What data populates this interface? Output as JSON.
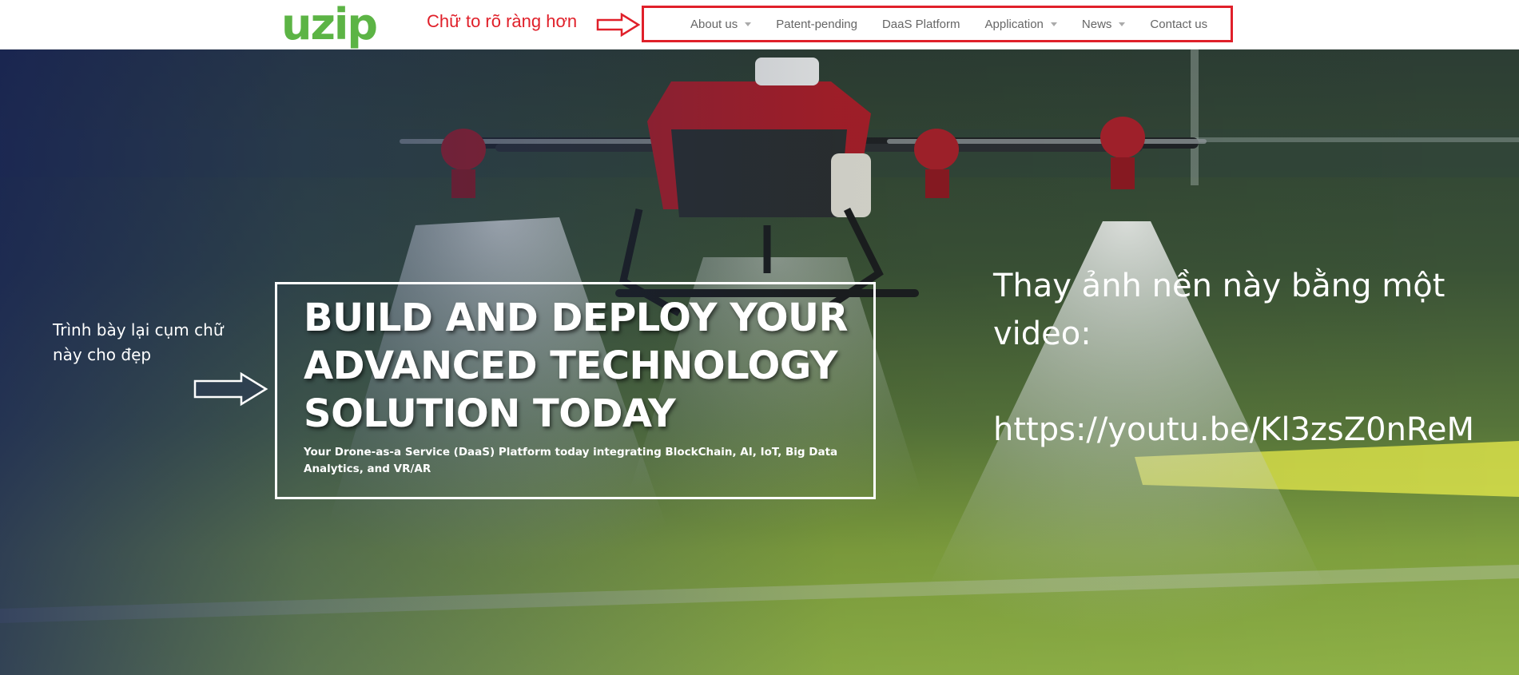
{
  "header": {
    "logo_text": "uzip",
    "logo_color": "#5cb445",
    "annotation": "Chữ to rõ ràng hơn",
    "nav": [
      {
        "label": "About us",
        "has_dropdown": true
      },
      {
        "label": "Patent-pending",
        "has_dropdown": false
      },
      {
        "label": "DaaS Platform",
        "has_dropdown": false
      },
      {
        "label": "Application",
        "has_dropdown": true
      },
      {
        "label": "News",
        "has_dropdown": true
      },
      {
        "label": "Contact us",
        "has_dropdown": false
      }
    ]
  },
  "hero": {
    "headline": "BUILD AND DEPLOY YOUR ADVANCED TECHNOLOGY SOLUTION TODAY",
    "subheadline": "Your Drone-as-a Service (DaaS) Platform today integrating BlockChain, AI, IoT, Big Data Analytics, and VR/AR",
    "annotation_left": "Trình bày lại cụm chữ này cho đẹp",
    "annotation_right": "Thay ảnh nền này bằng một video:",
    "annotation_url": "https://youtu.be/Kl3zsZ0nReM"
  },
  "colors": {
    "annotation_red": "#e0202a",
    "nav_text": "#666666",
    "hero_text": "#ffffff"
  }
}
